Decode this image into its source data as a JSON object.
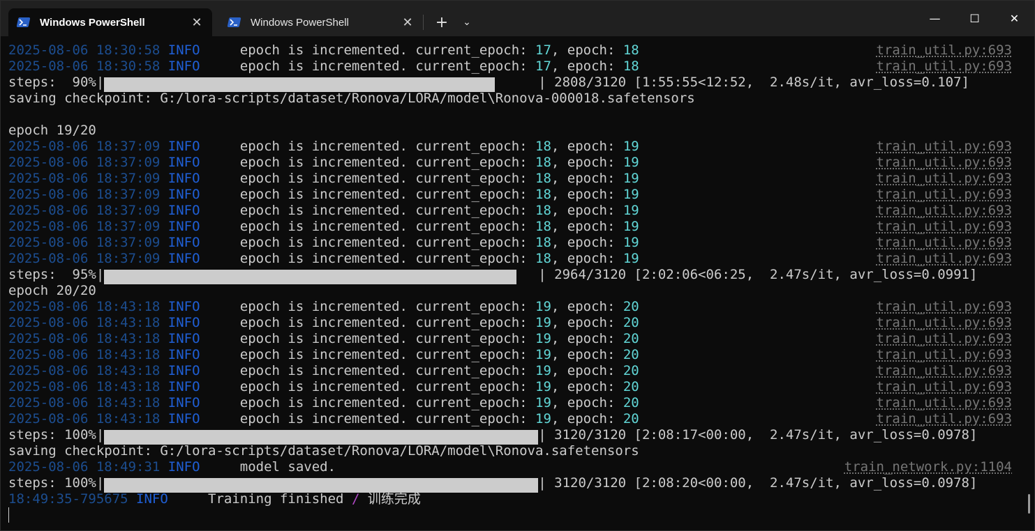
{
  "tabs": [
    {
      "label": "Windows PowerShell",
      "active": true
    },
    {
      "label": "Windows PowerShell",
      "active": false
    }
  ],
  "toolbar": {
    "close_glyph": "✕",
    "new_tab_glyph": "+",
    "dropdown_glyph": "⌄"
  },
  "window_controls": {
    "minimize": "—",
    "maximize": "☐",
    "close": "✕"
  },
  "colors": {
    "background": "#0c0c0c",
    "timestamp": "#1c4d8f",
    "info": "#1f5fd6",
    "number": "#61d6d6",
    "text": "#cccccc",
    "source": "#767676"
  },
  "terminal": {
    "lines": [
      {
        "type": "log",
        "ts": "2025-08-06 18:30:58",
        "level": "INFO",
        "msg": "epoch is incremented. current_epoch: ",
        "n1": "17",
        "mid": ", epoch: ",
        "n2": "18",
        "src": "train_util.py:693"
      },
      {
        "type": "log",
        "ts": "2025-08-06 18:30:58",
        "level": "INFO",
        "msg": "epoch is incremented. current_epoch: ",
        "n1": "17",
        "mid": ", epoch: ",
        "n2": "18",
        "src": "train_util.py:693"
      },
      {
        "type": "progress",
        "prefix": "steps:  90%|",
        "fraction": 0.9,
        "stats": "| 2808/3120 [1:55:55<12:52,  2.48s/it, avr_loss=0.107]"
      },
      {
        "type": "text",
        "text": "saving checkpoint: G:/lora-scripts/dataset/Ronova/LORA/model\\Ronova-000018.safetensors"
      },
      {
        "type": "text",
        "text": ""
      },
      {
        "type": "text",
        "text": "epoch 19/20"
      },
      {
        "type": "log",
        "ts": "2025-08-06 18:37:09",
        "level": "INFO",
        "msg": "epoch is incremented. current_epoch: ",
        "n1": "18",
        "mid": ", epoch: ",
        "n2": "19",
        "src": "train_util.py:693"
      },
      {
        "type": "log",
        "ts": "2025-08-06 18:37:09",
        "level": "INFO",
        "msg": "epoch is incremented. current_epoch: ",
        "n1": "18",
        "mid": ", epoch: ",
        "n2": "19",
        "src": "train_util.py:693"
      },
      {
        "type": "log",
        "ts": "2025-08-06 18:37:09",
        "level": "INFO",
        "msg": "epoch is incremented. current_epoch: ",
        "n1": "18",
        "mid": ", epoch: ",
        "n2": "19",
        "src": "train_util.py:693"
      },
      {
        "type": "log",
        "ts": "2025-08-06 18:37:09",
        "level": "INFO",
        "msg": "epoch is incremented. current_epoch: ",
        "n1": "18",
        "mid": ", epoch: ",
        "n2": "19",
        "src": "train_util.py:693"
      },
      {
        "type": "log",
        "ts": "2025-08-06 18:37:09",
        "level": "INFO",
        "msg": "epoch is incremented. current_epoch: ",
        "n1": "18",
        "mid": ", epoch: ",
        "n2": "19",
        "src": "train_util.py:693"
      },
      {
        "type": "log",
        "ts": "2025-08-06 18:37:09",
        "level": "INFO",
        "msg": "epoch is incremented. current_epoch: ",
        "n1": "18",
        "mid": ", epoch: ",
        "n2": "19",
        "src": "train_util.py:693"
      },
      {
        "type": "log",
        "ts": "2025-08-06 18:37:09",
        "level": "INFO",
        "msg": "epoch is incremented. current_epoch: ",
        "n1": "18",
        "mid": ", epoch: ",
        "n2": "19",
        "src": "train_util.py:693"
      },
      {
        "type": "log",
        "ts": "2025-08-06 18:37:09",
        "level": "INFO",
        "msg": "epoch is incremented. current_epoch: ",
        "n1": "18",
        "mid": ", epoch: ",
        "n2": "19",
        "src": "train_util.py:693"
      },
      {
        "type": "progress",
        "prefix": "steps:  95%|",
        "fraction": 0.95,
        "stats": "| 2964/3120 [2:02:06<06:25,  2.47s/it, avr_loss=0.0991]"
      },
      {
        "type": "text",
        "text": "epoch 20/20"
      },
      {
        "type": "log",
        "ts": "2025-08-06 18:43:18",
        "level": "INFO",
        "msg": "epoch is incremented. current_epoch: ",
        "n1": "19",
        "mid": ", epoch: ",
        "n2": "20",
        "src": "train_util.py:693"
      },
      {
        "type": "log",
        "ts": "2025-08-06 18:43:18",
        "level": "INFO",
        "msg": "epoch is incremented. current_epoch: ",
        "n1": "19",
        "mid": ", epoch: ",
        "n2": "20",
        "src": "train_util.py:693"
      },
      {
        "type": "log",
        "ts": "2025-08-06 18:43:18",
        "level": "INFO",
        "msg": "epoch is incremented. current_epoch: ",
        "n1": "19",
        "mid": ", epoch: ",
        "n2": "20",
        "src": "train_util.py:693"
      },
      {
        "type": "log",
        "ts": "2025-08-06 18:43:18",
        "level": "INFO",
        "msg": "epoch is incremented. current_epoch: ",
        "n1": "19",
        "mid": ", epoch: ",
        "n2": "20",
        "src": "train_util.py:693"
      },
      {
        "type": "log",
        "ts": "2025-08-06 18:43:18",
        "level": "INFO",
        "msg": "epoch is incremented. current_epoch: ",
        "n1": "19",
        "mid": ", epoch: ",
        "n2": "20",
        "src": "train_util.py:693"
      },
      {
        "type": "log",
        "ts": "2025-08-06 18:43:18",
        "level": "INFO",
        "msg": "epoch is incremented. current_epoch: ",
        "n1": "19",
        "mid": ", epoch: ",
        "n2": "20",
        "src": "train_util.py:693"
      },
      {
        "type": "log",
        "ts": "2025-08-06 18:43:18",
        "level": "INFO",
        "msg": "epoch is incremented. current_epoch: ",
        "n1": "19",
        "mid": ", epoch: ",
        "n2": "20",
        "src": "train_util.py:693"
      },
      {
        "type": "log",
        "ts": "2025-08-06 18:43:18",
        "level": "INFO",
        "msg": "epoch is incremented. current_epoch: ",
        "n1": "19",
        "mid": ", epoch: ",
        "n2": "20",
        "src": "train_util.py:693"
      },
      {
        "type": "progress",
        "prefix": "steps: 100%|",
        "fraction": 1.0,
        "stats": "| 3120/3120 [2:08:17<00:00,  2.47s/it, avr_loss=0.0978]"
      },
      {
        "type": "text",
        "text": "saving checkpoint: G:/lora-scripts/dataset/Ronova/LORA/model\\Ronova.safetensors"
      },
      {
        "type": "log",
        "ts": "2025-08-06 18:49:31",
        "level": "INFO",
        "msg": "model saved.",
        "n1": "",
        "mid": "",
        "n2": "",
        "src": "train_network.py:1104"
      },
      {
        "type": "progress",
        "prefix": "steps: 100%|",
        "fraction": 1.0,
        "stats": "| 3120/3120 [2:08:20<00:00,  2.47s/it, avr_loss=0.0978]"
      },
      {
        "type": "final",
        "ts": "18:49:35-795675",
        "level": "INFO",
        "msg": "Training finished",
        "slash": "/",
        "msg2": "训练完成"
      },
      {
        "type": "cursor"
      }
    ]
  }
}
